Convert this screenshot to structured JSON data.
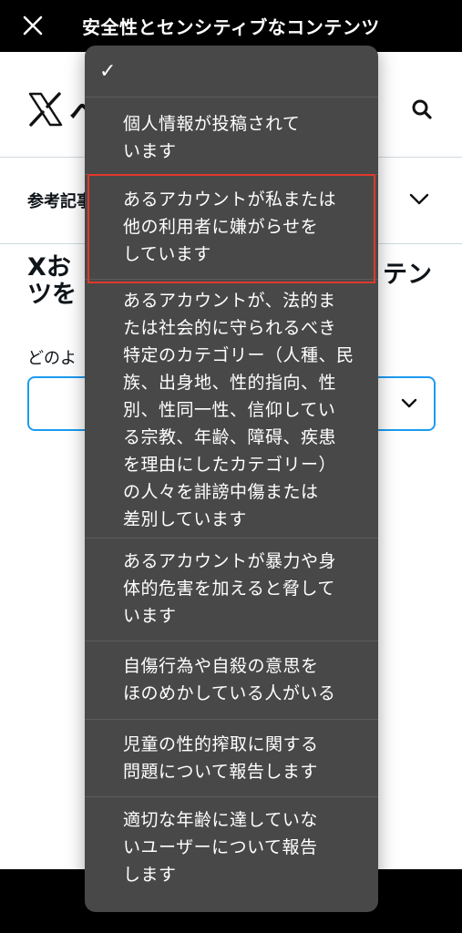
{
  "topbar": {
    "title": "安全性とセンシティブなコンテンツ"
  },
  "header": {
    "logo_tail": "へ"
  },
  "reference": {
    "label": "参考記事"
  },
  "heading": {
    "left_line1": "Xお",
    "left_line2": "ツを",
    "right": "テン"
  },
  "question": {
    "label": "どのよ"
  },
  "dropdown": {
    "selected_mark": "✓",
    "items": [
      {
        "label": "個人情報が投稿されて\nいます"
      },
      {
        "label": "あるアカウントが私または\n他の利用者に嫌がらせを\nしています"
      },
      {
        "label": "あるアカウントが、法的ま\nたは社会的に守られるべき\n特定のカテゴリー（人種、民\n族、出身地、性的指向、性\n別、性同一性、信仰してい\nる宗教、年齢、障碍、疾患\nを理由にしたカテゴリー）\nの人々を誹謗中傷または\n差別しています"
      },
      {
        "label": "あるアカウントが暴力や身\n体的危害を加えると脅して\nいます"
      },
      {
        "label": "自傷行為や自殺の意思を\nほのめかしている人がいる"
      },
      {
        "label": "児童の性的搾取に関する\n問題について報告します"
      },
      {
        "label": "適切な年齢に達していな\nいユーザーについて報告\nします"
      }
    ]
  },
  "colors": {
    "accent": "#1d9bf0",
    "highlight": "#e0392b",
    "menu_bg": "#484848"
  }
}
